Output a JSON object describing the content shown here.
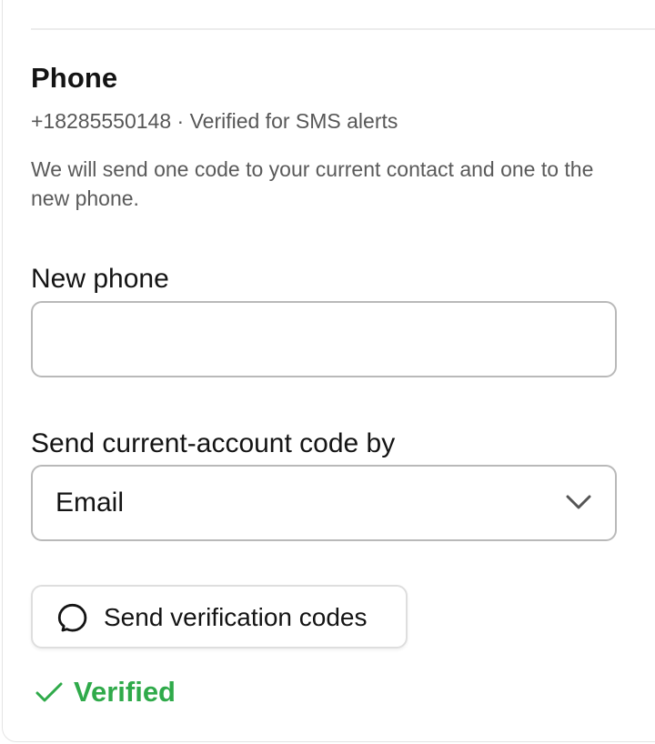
{
  "phone_section": {
    "title": "Phone",
    "current_value": "+18285550148 · Verified for SMS alerts",
    "description": "We will send one code to your current contact and one to the new phone."
  },
  "new_phone": {
    "label": "New phone",
    "value": "",
    "placeholder": ""
  },
  "code_method": {
    "label": "Send current-account code by",
    "selected": "Email",
    "icon": "chevron-down-icon"
  },
  "send_button": {
    "label": "Send verification codes",
    "icon": "chat-bubble-icon"
  },
  "status": {
    "text": "Verified",
    "icon": "check-icon",
    "color": "#2faa4a"
  },
  "colors": {
    "text_primary": "#141414",
    "text_secondary": "#575757",
    "border": "#b9b9b9",
    "success": "#2faa4a"
  }
}
